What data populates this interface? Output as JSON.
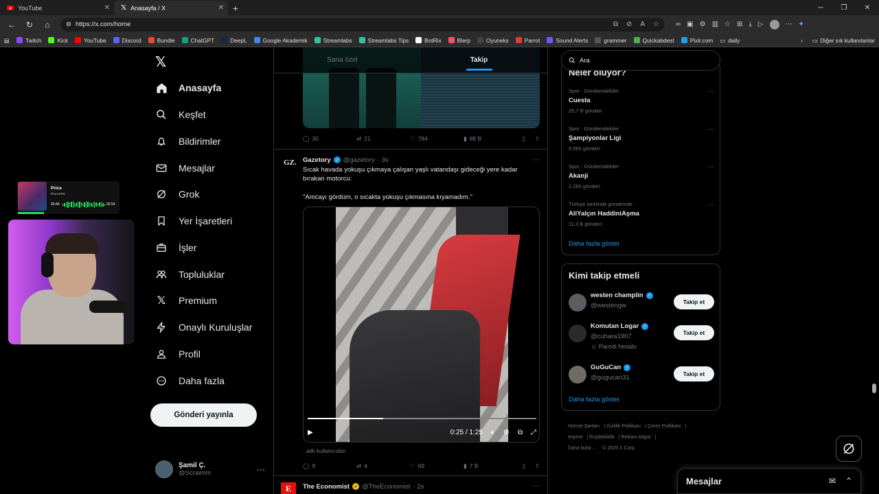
{
  "browser": {
    "tabs": [
      {
        "title": "YouTube",
        "icon": "youtube-favicon"
      },
      {
        "title": "Anasayfa / X",
        "icon": "x-favicon"
      }
    ],
    "url": "https://x.com/home",
    "bookmarks": [
      "Twitch",
      "Kick",
      "YouTube",
      "Discord",
      "Bundle",
      "ChatGPT",
      "DeepL",
      "Google Akademik",
      "Streamlabs",
      "Streamlabs Tips",
      "BotRix",
      "Blerp",
      "Oyuneks",
      "Parrot",
      "Sound Alerts",
      "grammer",
      "Quickabdest",
      "Pixlr.com",
      "daily"
    ],
    "bookmark_colors": [
      "#9146ff",
      "#53fc18",
      "#ff0000",
      "#5865f2",
      "#e8453c",
      "#10a37f",
      "#0f2b46",
      "#4285f4",
      "#31c3a2",
      "#31c3a2",
      "#ffffff",
      "#ff4d6d",
      "#444444",
      "#e53935",
      "#6b5bff",
      "#555555",
      "#4caf50",
      "#1da1f2",
      "#888888"
    ],
    "other_bookmarks": "Diğer sık kullanılanlar"
  },
  "nav": {
    "items": [
      {
        "label": "Anasayfa",
        "icon": "home-icon"
      },
      {
        "label": "Keşfet",
        "icon": "search-icon"
      },
      {
        "label": "Bildirimler",
        "icon": "bell-icon"
      },
      {
        "label": "Mesajlar",
        "icon": "mail-icon"
      },
      {
        "label": "Grok",
        "icon": "grok-icon"
      },
      {
        "label": "Yer İşaretleri",
        "icon": "bookmark-icon"
      },
      {
        "label": "İşler",
        "icon": "briefcase-icon"
      },
      {
        "label": "Topluluklar",
        "icon": "people-icon"
      },
      {
        "label": "Premium",
        "icon": "x-icon"
      },
      {
        "label": "Onaylı Kuruluşlar",
        "icon": "lightning-icon"
      },
      {
        "label": "Profil",
        "icon": "person-icon"
      },
      {
        "label": "Daha fazla",
        "icon": "more-circle-icon"
      }
    ],
    "post_button": "Gönderi yayınla",
    "account": {
      "name": "Şamil Ç.",
      "handle": "@Scraimm"
    }
  },
  "overlay": {
    "song": "Price",
    "artist": "PALASTIC",
    "elapsed": "00:46",
    "duration": "02:54",
    "progress": 0.26
  },
  "timeline": {
    "tabs": [
      {
        "label": "Sana özel"
      },
      {
        "label": "Takip",
        "active": true
      }
    ],
    "prev_post_stats": {
      "replies": "30",
      "reposts": "21",
      "likes": "784",
      "views": "88 B"
    },
    "post": {
      "avatar_text": "GZ.",
      "name": "Gazetory",
      "handle": "@gazetory",
      "time": "· 3s",
      "text1": "Sıcak havada yokuşu çıkmaya çalışan yaşlı vatandaşı gideceği yere kadar bırakan motorcu:",
      "text2": "\"Amcayı gördüm, o sıcakta yokuşu çıkmasına kıyamadım.\"",
      "video_time": "0:25 / 1:25",
      "video_progress": 0.33,
      "from_user": "adlı kullanıcıdan",
      "stats": {
        "replies": "9",
        "reposts": "4",
        "likes": "69",
        "views": "7 B"
      }
    },
    "next_post": {
      "name": "The Economist",
      "handle": "@TheEconomist",
      "time": "· 2s",
      "logo": "E"
    }
  },
  "right": {
    "search_placeholder": "Ara",
    "trends_title": "Neler oluyor?",
    "trends": [
      {
        "category": "Spor · Gündemdekiler",
        "name": "Cuesta",
        "count": "25,7 B gönderi"
      },
      {
        "category": "Spor · Gündemdekiler",
        "name": "Şampiyonlar Ligi",
        "count": "5.565 gönderi"
      },
      {
        "category": "Spor · Gündemdekiler",
        "name": "Akanji",
        "count": "2.265 gönderi"
      },
      {
        "category": "Türkiye tarihinde gündemde",
        "name": "AliYalçın HaddiniAşma",
        "count": "11,3 B gönderi"
      }
    ],
    "trends_more": "Daha fazla göster",
    "follow_title": "Kimi takip etmeli",
    "who_to_follow": [
      {
        "name": "westen champlin",
        "handle": "@westengw",
        "extra": ""
      },
      {
        "name": "Komutan Logar",
        "handle": "@cuhara1907",
        "extra": "Parodi hesabı"
      },
      {
        "name": "GuGuCan",
        "handle": "@gugucan31",
        "extra": ""
      }
    ],
    "follow_button": "Takip et",
    "follow_more": "Daha fazla göster",
    "footer": [
      "Hizmet Şartları",
      "Gizlilik Politikası",
      "Çerez Politikası",
      "Imprint",
      "Erişilebilirlik",
      "Reklam bilgisi",
      "Daha fazla ···",
      "© 2025 X Corp."
    ]
  },
  "dm": {
    "title": "Mesajlar"
  },
  "colors": {
    "accent": "#1d9bf0",
    "background": "#000000",
    "text": "#e7e9ea",
    "muted": "#71767b",
    "border": "#2f3336"
  }
}
